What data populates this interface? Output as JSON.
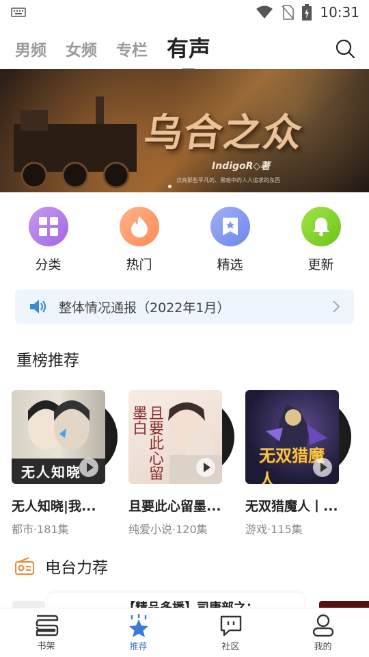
{
  "status": {
    "time": "10:31"
  },
  "tabs": [
    {
      "label": "男频"
    },
    {
      "label": "女频"
    },
    {
      "label": "专栏"
    },
    {
      "label": "有声"
    }
  ],
  "banner": {
    "title": "乌合之众",
    "author": "IndigoR◇著",
    "tagline": "点亮那些平凡的、黑暗中的人人追求的东西",
    "colors": {
      "bg": "#3a2a1c",
      "title": "#e8c39a"
    }
  },
  "categories": [
    {
      "label": "分类",
      "icon": "grid-icon",
      "color": "#b77ee6"
    },
    {
      "label": "热门",
      "icon": "flame-icon",
      "color": "#ff9d6e"
    },
    {
      "label": "精选",
      "icon": "star-bookmark-icon",
      "color": "#7c94f0"
    },
    {
      "label": "更新",
      "icon": "bell-icon",
      "color": "#7ed321"
    }
  ],
  "notice": {
    "text": "整体情况通报（2022年1月）",
    "icon": "speaker-icon"
  },
  "ranking": {
    "title": "重榜推荐",
    "books": [
      {
        "title": "无人知晓|我...",
        "meta": "都市·181集",
        "cover_text": "无人知晓"
      },
      {
        "title": "且要此心留墨...",
        "meta": "纯爱小说·120集",
        "cover_text": "且要此心留墨白"
      },
      {
        "title": "无双猎魔人丨...",
        "meta": "游戏·115集",
        "cover_text": "无双猎魔人"
      }
    ]
  },
  "radio": {
    "title": "电台力荐",
    "peek_title": "【精品多播】司康部之："
  },
  "bottom_nav": [
    {
      "label": "书架",
      "icon": "bookshelf-icon"
    },
    {
      "label": "推荐",
      "icon": "star-icon"
    },
    {
      "label": "社区",
      "icon": "chat-icon"
    },
    {
      "label": "我的",
      "icon": "user-icon"
    }
  ]
}
